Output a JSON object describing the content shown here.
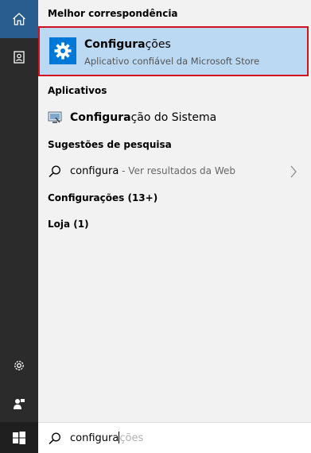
{
  "sections": {
    "best_match": "Melhor correspondência",
    "apps": "Aplicativos",
    "suggestions": "Sugestões de pesquisa",
    "settings": "Configurações (13+)",
    "store": "Loja (1)"
  },
  "best_match_item": {
    "title_bold": "Configura",
    "title_rest": "ções",
    "subtitle": "Aplicativo confiável da Microsoft Store",
    "icon": "gear-icon"
  },
  "apps": [
    {
      "label_bold": "Configura",
      "label_rest": "ção do Sistema",
      "icon": "system-settings-icon"
    }
  ],
  "suggestions": [
    {
      "query": "configura",
      "hint": " - Ver resultados da Web",
      "icon": "search-icon"
    }
  ],
  "search": {
    "typed": "configura",
    "autocomplete": "ções"
  },
  "rail": {
    "icons": [
      "home-icon",
      "notebook-icon",
      "settings-gear-icon",
      "feedback-icon",
      "windows-start-icon"
    ]
  },
  "colors": {
    "rail": "#2b2b2b",
    "rail_active": "#2a5d8f",
    "highlight": "#bcd9f3",
    "highlight_border": "#d4121f",
    "accent": "#0078d7"
  }
}
